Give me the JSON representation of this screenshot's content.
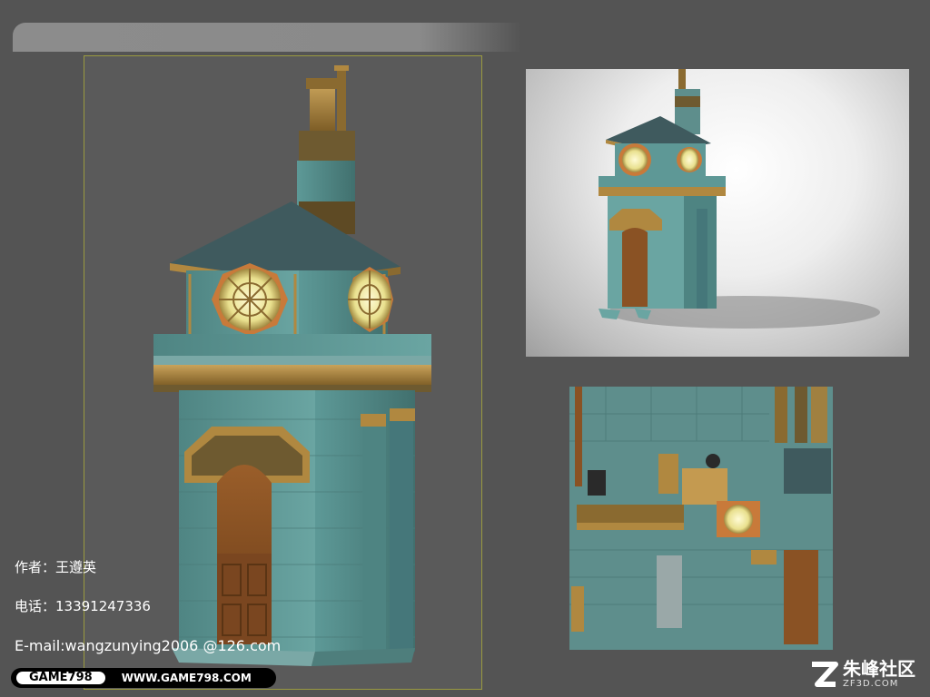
{
  "author": {
    "text": "作者：王遵英"
  },
  "phone": {
    "text": "电话：13391247336"
  },
  "email": {
    "text": "E-mail:wangzunying2006 @126.com"
  },
  "footer": {
    "brand": "GAME798",
    "url": "WWW.GAME798.COM"
  },
  "watermark": {
    "chinese": "朱峰社区",
    "english": "ZF3D.COM"
  },
  "images": {
    "main_view": "clock-tower-model-perspective",
    "render_view": "clock-tower-render-white-background",
    "texture_view": "texture-atlas"
  },
  "colors": {
    "background": "#545454",
    "stone": "#5e9896",
    "brass": "#b08840",
    "wood": "#8a5224",
    "roof": "#3f5a5e",
    "glass": "#f3efb0"
  }
}
